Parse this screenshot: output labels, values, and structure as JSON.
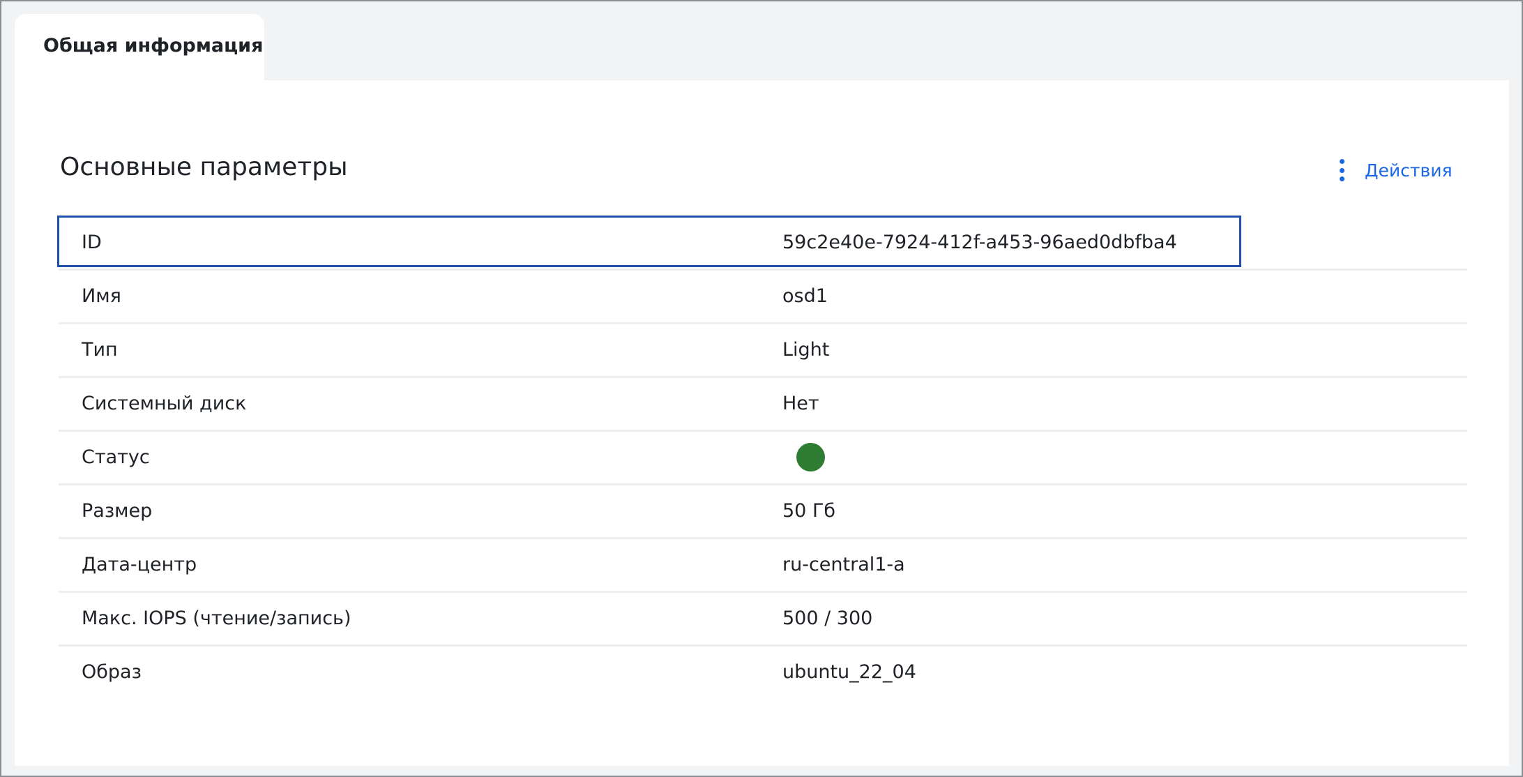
{
  "tabs": [
    {
      "label": "Общая информация"
    }
  ],
  "section": {
    "title": "Основные параметры",
    "actions_label": "Действия"
  },
  "rows": [
    {
      "label": "ID",
      "value": "59c2e40e-7924-412f-a453-96aed0dbfba4"
    },
    {
      "label": "Имя",
      "value": "osd1"
    },
    {
      "label": "Тип",
      "value": "Light"
    },
    {
      "label": "Системный диск",
      "value": "Нет"
    },
    {
      "label": "Статус",
      "value": null,
      "status_color": "#2e7d32"
    },
    {
      "label": "Размер",
      "value": "50 Гб"
    },
    {
      "label": "Дата-центр",
      "value": "ru-central1-a"
    },
    {
      "label": "Макс. IOPS (чтение/запись)",
      "value": "500 / 300"
    },
    {
      "label": "Образ",
      "value": "ubuntu_22_04"
    }
  ],
  "colors": {
    "accent": "#1a66e6",
    "status_ok": "#2e7d32",
    "focus": "#1f4fa8"
  },
  "icons": {
    "actions": "more-vertical-icon"
  }
}
